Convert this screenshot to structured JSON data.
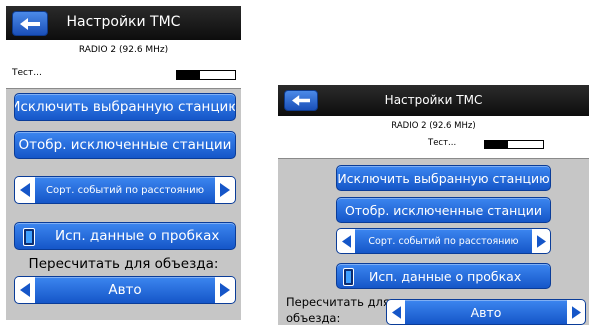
{
  "header": {
    "title": "Настройки TMC",
    "back_icon": "back-arrow-icon"
  },
  "info": {
    "station": "RADIO 2 (92.6 MHz)",
    "status": "Тест...",
    "signal_level": 0.4
  },
  "buttons": {
    "exclude_station": "Исключить выбранную станцию",
    "show_excluded": "Отобр. исключенные станции"
  },
  "sort_selector": {
    "value": "Сорт. событий по расстоянию",
    "prev_icon": "triangle-left-icon",
    "next_icon": "triangle-right-icon"
  },
  "traffic_toggle": {
    "label": "Исп. данные о пробках",
    "checked": true
  },
  "detour": {
    "label": "Пересчитать для объезда:",
    "label_line1": "Пересчитать для",
    "label_line2": "объезда:",
    "value": "Авто"
  },
  "colors": {
    "button_blue": "#1e64dc",
    "background": "#c6c6c6",
    "header": "#111111"
  }
}
